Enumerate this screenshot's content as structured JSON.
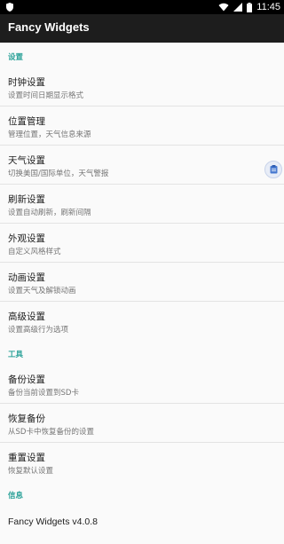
{
  "status": {
    "time": "11:45"
  },
  "app": {
    "title": "Fancy Widgets"
  },
  "sections": {
    "settings": {
      "header": "设置",
      "items": [
        {
          "title": "时钟设置",
          "subtitle": "设置时间日期显示格式"
        },
        {
          "title": "位置管理",
          "subtitle": "管理位置，天气信息来源"
        },
        {
          "title": "天气设置",
          "subtitle": "切换美国/国际单位，天气警报"
        },
        {
          "title": "刷新设置",
          "subtitle": "设置自动刷新，刷新间隔"
        },
        {
          "title": "外观设置",
          "subtitle": "自定义风格样式"
        },
        {
          "title": "动画设置",
          "subtitle": "设置天气及解锁动画"
        },
        {
          "title": "高级设置",
          "subtitle": "设置高级行为选项"
        }
      ]
    },
    "tools": {
      "header": "工具",
      "items": [
        {
          "title": "备份设置",
          "subtitle": "备份当前设置到SD卡"
        },
        {
          "title": "恢复备份",
          "subtitle": "从SD卡中恢复备份的设置"
        },
        {
          "title": "重置设置",
          "subtitle": "恢复默认设置"
        }
      ]
    },
    "info": {
      "header": "信息",
      "version": "Fancy Widgets v4.0.8"
    }
  },
  "colors": {
    "accent": "#2aa198",
    "appbar": "#1d1d1d",
    "statusbar": "#000000",
    "background": "#fafafa"
  }
}
